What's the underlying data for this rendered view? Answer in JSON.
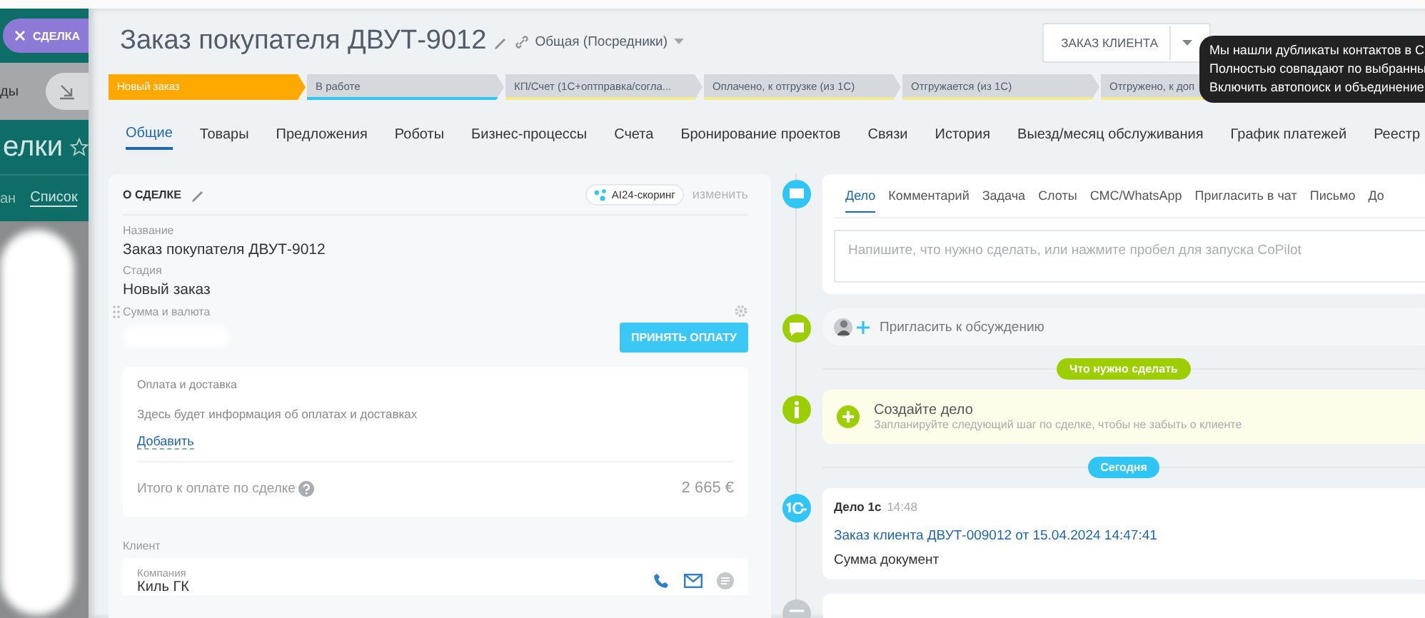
{
  "sidebar": {
    "close_label": "СДЕЛКА",
    "fragment": "ды",
    "heading": "елки",
    "views": [
      {
        "label": "ан",
        "selected": false
      },
      {
        "label": "Список",
        "selected": true
      }
    ]
  },
  "header": {
    "title": "Заказ покупателя ДВУТ-9012",
    "category": "Общая (Посредники)",
    "primary_button": "ЗАКАЗ КЛИЕНТА"
  },
  "stages": [
    {
      "label": "Новый заказ",
      "active": true,
      "color": "#ffa900"
    },
    {
      "label": "В работе",
      "active": false,
      "color": "#2fc6f6"
    },
    {
      "label": "КП/Счет (1С+оптправка/согла...",
      "active": false,
      "color": "#f5ea8c"
    },
    {
      "label": "Оплачено, к отгрузке (из 1С)",
      "active": false,
      "color": "#f5ea8c"
    },
    {
      "label": "Отгружается (из 1С)",
      "active": false,
      "color": "#f5ea8c"
    },
    {
      "label": "Отгружено, к доп",
      "active": false,
      "color": "#f5ea8c"
    }
  ],
  "tabs": [
    {
      "label": "Общие",
      "selected": true
    },
    {
      "label": "Товары",
      "selected": false
    },
    {
      "label": "Предложения",
      "selected": false
    },
    {
      "label": "Роботы",
      "selected": false
    },
    {
      "label": "Бизнес-процессы",
      "selected": false
    },
    {
      "label": "Счета",
      "selected": false
    },
    {
      "label": "Бронирование проектов",
      "selected": false
    },
    {
      "label": "Связи",
      "selected": false
    },
    {
      "label": "История",
      "selected": false
    },
    {
      "label": "Выезд/месяц обслуживания",
      "selected": false
    },
    {
      "label": "График платежей",
      "selected": false
    },
    {
      "label": "Реестр",
      "selected": false
    }
  ],
  "deal_card": {
    "title": "О СДЕЛКЕ",
    "scoring": "AI24-скоринг",
    "edit_link": "изменить",
    "fields": [
      {
        "label": "Название",
        "value": "Заказ покупателя ДВУТ-9012"
      },
      {
        "label": "Стадия",
        "value": "Новый заказ"
      }
    ],
    "amount_label": "Сумма и валюта",
    "pay_button": "ПРИНЯТЬ ОПЛАТУ",
    "payments": {
      "title": "Оплата и доставка",
      "empty_text": "Здесь будет информация об оплатах и доставках",
      "add_link": "Добавить",
      "total_label": "Итого к оплате по сделке",
      "total_value": "2 665 €"
    },
    "client": {
      "label": "Клиент",
      "company_label": "Компания",
      "company": "Киль ГК"
    }
  },
  "timeline": {
    "composer": {
      "tabs": [
        {
          "label": "Дело",
          "selected": true
        },
        {
          "label": "Комментарий",
          "selected": false
        },
        {
          "label": "Задача",
          "selected": false
        },
        {
          "label": "Слоты",
          "selected": false
        },
        {
          "label": "СМС/WhatsApp",
          "selected": false
        },
        {
          "label": "Пригласить в чат",
          "selected": false
        },
        {
          "label": "Письмо",
          "selected": false
        },
        {
          "label": "До",
          "selected": false
        }
      ],
      "placeholder": "Напишите, что нужно сделать, или нажмите пробел для запуска CoPilot"
    },
    "invite": "Пригласить к обсуждению",
    "items": [
      {
        "kind": "badge",
        "label": "Что нужно сделать",
        "color": "#9dcf00"
      },
      {
        "kind": "todo",
        "title": "Создайте дело",
        "subtitle": "Запланируйте следующий шаг по сделке, чтобы не забыть о клиенте"
      },
      {
        "kind": "badge",
        "label": "Сегодня",
        "color": "#2fc6f6"
      },
      {
        "kind": "document",
        "title": "Дело 1с",
        "time": "14:48",
        "link": "Заказ клиента ДВУТ-009012 от 15.04.2024 14:47:41",
        "text": "Сумма документ"
      },
      {
        "kind": "stub"
      }
    ]
  },
  "tooltip": {
    "lines": [
      "Мы нашли дубликаты контактов в С",
      "Полностью совпадают по выбранны",
      "Включить автопоиск и объединение"
    ]
  }
}
